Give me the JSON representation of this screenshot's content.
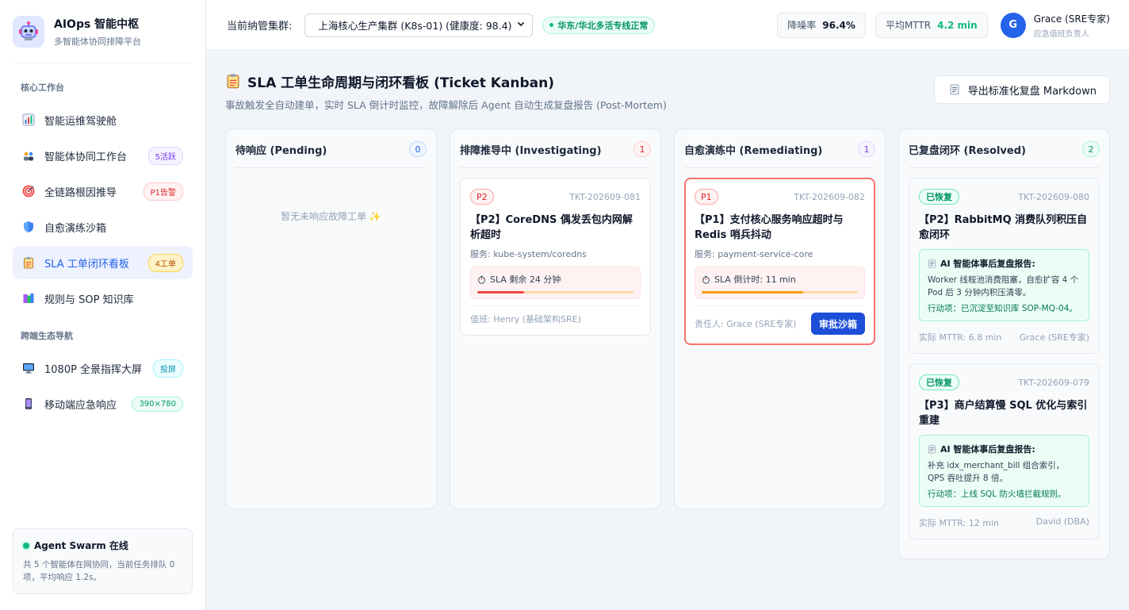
{
  "brand": {
    "title": "AIOps 智能中枢",
    "subtitle": "多智能体协同排障平台"
  },
  "sidebar": {
    "section1": "核心工作台",
    "section2": "跨端生态导航",
    "items": [
      {
        "label": "智能运维驾驶舱",
        "icon": "chart-icon"
      },
      {
        "label": "智能体协同工作台",
        "icon": "agents-icon",
        "badge": "5活跃"
      },
      {
        "label": "全链路根因推导",
        "icon": "target-icon",
        "badge": "P1告警"
      },
      {
        "label": "自愈演练沙箱",
        "icon": "shield-icon"
      },
      {
        "label": "SLA 工单闭环看板",
        "icon": "clipboard-icon",
        "badge": "4工单",
        "active": true
      },
      {
        "label": "规则与 SOP 知识库",
        "icon": "books-icon"
      }
    ],
    "eco_items": [
      {
        "label": "1080P 全景指挥大屏",
        "icon": "monitor-icon",
        "badge": "投屏"
      },
      {
        "label": "移动端应急响应",
        "icon": "mobile-icon",
        "badge": "390×780"
      }
    ],
    "swarm": {
      "title": "Agent Swarm 在线",
      "desc": "共 5 个智能体在网协同，当前任务排队 0 项，平均响应 1.2s。"
    }
  },
  "topbar": {
    "cluster_label": "当前纳管集群:",
    "cluster_value": "上海核心生产集群 (K8s-01) (健康度: 98.4)",
    "status": "华东/华北多活专线正常",
    "noise_label": "降噪率",
    "noise_value": "96.4%",
    "mttr_label": "平均MTTR",
    "mttr_value": "4.2 min",
    "user_initial": "G",
    "user_name": "Grace (SRE专家)",
    "user_role": "应急值班负责人"
  },
  "page": {
    "title": "SLA 工单生命周期与闭环看板 (Ticket Kanban)",
    "subtitle": "事故触发全自动建单，实时 SLA 倒计时监控，故障解除后 Agent 自动生成复盘报告 (Post-Mortem)",
    "export_label": "导出标准化复盘 Markdown"
  },
  "columns": {
    "pending": {
      "title": "待响应 (Pending)",
      "count": "0",
      "empty": "暂无未响应故障工单 ✨"
    },
    "investigating": {
      "title": "排障推导中 (Investigating)",
      "count": "1"
    },
    "remediating": {
      "title": "自愈演练中 (Remediating)",
      "count": "1"
    },
    "resolved": {
      "title": "已复盘闭环 (Resolved)",
      "count": "2"
    }
  },
  "cards": {
    "inv": {
      "priority": "P2",
      "id": "TKT-202609-081",
      "title": "【P2】CoreDNS 偶发丢包内网解析超时",
      "service": "服务: kube-system/coredns",
      "sla": "SLA 剩余 24 分钟",
      "sla_progress": 0.3,
      "sla_color": "#ef4444",
      "footer": "值班: Henry (基础架构SRE)"
    },
    "rem": {
      "priority": "P1",
      "id": "TKT-202609-082",
      "title": "【P1】支付核心服务响应超时与 Redis 哨兵抖动",
      "service": "服务: payment-service-core",
      "sla": "SLA 倒计时: 11 min",
      "sla_progress": 0.65,
      "sla_color": "#f59e0b",
      "owner": "责任人: Grace (SRE专家)",
      "action": "审批沙箱"
    },
    "res1": {
      "status": "已恢复",
      "id": "TKT-202609-080",
      "title": "【P2】RabbitMQ 消费队列积压自愈闭环",
      "report_title": "AI 智能体事后复盘报告:",
      "report_body": "Worker 线程池消费阻塞，自愈扩容 4 个 Pod 后 3 分钟内积压清零。",
      "report_action": "行动项：已沉淀至知识库 SOP-MQ-04。",
      "mttr": "实际 MTTR: 6.8 min",
      "owner": "Grace (SRE专家)"
    },
    "res2": {
      "status": "已恢复",
      "id": "TKT-202609-079",
      "title": "【P3】商户结算慢 SQL 优化与索引重建",
      "report_title": "AI 智能体事后复盘报告:",
      "report_body": "补充 idx_merchant_bill 组合索引，QPS 吞吐提升 8 倍。",
      "report_action": "行动项：上线 SQL 防火墙拦截规则。",
      "mttr": "实际 MTTR: 12 min",
      "owner": "David (DBA)"
    }
  }
}
